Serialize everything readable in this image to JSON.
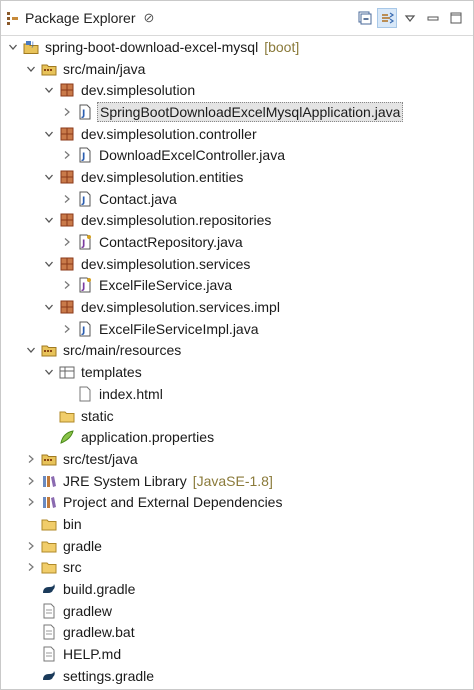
{
  "view": {
    "title": "Package Explorer",
    "close_symbol": "⊘"
  },
  "toolbar": {
    "collapse_all_icon": "collapse-all-icon",
    "link_editor_icon": "link-with-editor-icon",
    "view_menu_icon": "view-menu-icon",
    "minimize_icon": "minimize-icon",
    "maximize_icon": "maximize-icon"
  },
  "tree": [
    {
      "depth": 0,
      "arrow": "expanded",
      "icon": "project",
      "label": "spring-boot-download-excel-mysql",
      "deco": "[boot]"
    },
    {
      "depth": 1,
      "arrow": "expanded",
      "icon": "src-folder",
      "label": "src/main/java"
    },
    {
      "depth": 2,
      "arrow": "expanded",
      "icon": "package",
      "label": "dev.simplesolution"
    },
    {
      "depth": 3,
      "arrow": "collapsed",
      "icon": "java",
      "label": "SpringBootDownloadExcelMysqlApplication.java",
      "selected": true
    },
    {
      "depth": 2,
      "arrow": "expanded",
      "icon": "package",
      "label": "dev.simplesolution.controller"
    },
    {
      "depth": 3,
      "arrow": "collapsed",
      "icon": "java",
      "label": "DownloadExcelController.java"
    },
    {
      "depth": 2,
      "arrow": "expanded",
      "icon": "package",
      "label": "dev.simplesolution.entities"
    },
    {
      "depth": 3,
      "arrow": "collapsed",
      "icon": "java",
      "label": "Contact.java"
    },
    {
      "depth": 2,
      "arrow": "expanded",
      "icon": "package",
      "label": "dev.simplesolution.repositories"
    },
    {
      "depth": 3,
      "arrow": "collapsed",
      "icon": "java-interface",
      "label": "ContactRepository.java"
    },
    {
      "depth": 2,
      "arrow": "expanded",
      "icon": "package",
      "label": "dev.simplesolution.services"
    },
    {
      "depth": 3,
      "arrow": "collapsed",
      "icon": "java-interface",
      "label": "ExcelFileService.java"
    },
    {
      "depth": 2,
      "arrow": "expanded",
      "icon": "package",
      "label": "dev.simplesolution.services.impl"
    },
    {
      "depth": 3,
      "arrow": "collapsed",
      "icon": "java",
      "label": "ExcelFileServiceImpl.java"
    },
    {
      "depth": 1,
      "arrow": "expanded",
      "icon": "src-folder",
      "label": "src/main/resources"
    },
    {
      "depth": 2,
      "arrow": "expanded",
      "icon": "templates-folder",
      "label": "templates"
    },
    {
      "depth": 3,
      "arrow": "none",
      "icon": "html-file",
      "label": "index.html"
    },
    {
      "depth": 2,
      "arrow": "none",
      "icon": "folder",
      "label": "static"
    },
    {
      "depth": 2,
      "arrow": "none",
      "icon": "properties-file",
      "label": "application.properties"
    },
    {
      "depth": 1,
      "arrow": "collapsed",
      "icon": "src-folder",
      "label": "src/test/java"
    },
    {
      "depth": 1,
      "arrow": "collapsed",
      "icon": "library",
      "label": "JRE System Library",
      "deco": "[JavaSE-1.8]"
    },
    {
      "depth": 1,
      "arrow": "collapsed",
      "icon": "library",
      "label": "Project and External Dependencies"
    },
    {
      "depth": 1,
      "arrow": "none",
      "icon": "folder",
      "label": "bin"
    },
    {
      "depth": 1,
      "arrow": "collapsed",
      "icon": "folder",
      "label": "gradle"
    },
    {
      "depth": 1,
      "arrow": "collapsed",
      "icon": "folder",
      "label": "src"
    },
    {
      "depth": 1,
      "arrow": "none",
      "icon": "gradle-file",
      "label": "build.gradle"
    },
    {
      "depth": 1,
      "arrow": "none",
      "icon": "text-file",
      "label": "gradlew"
    },
    {
      "depth": 1,
      "arrow": "none",
      "icon": "text-file",
      "label": "gradlew.bat"
    },
    {
      "depth": 1,
      "arrow": "none",
      "icon": "text-file",
      "label": "HELP.md"
    },
    {
      "depth": 1,
      "arrow": "none",
      "icon": "gradle-file",
      "label": "settings.gradle"
    }
  ],
  "colors": {
    "package": "#a0522d",
    "folder": "#e8b84a",
    "java_blue": "#2a5db0",
    "deco": "#8a7a3a"
  }
}
